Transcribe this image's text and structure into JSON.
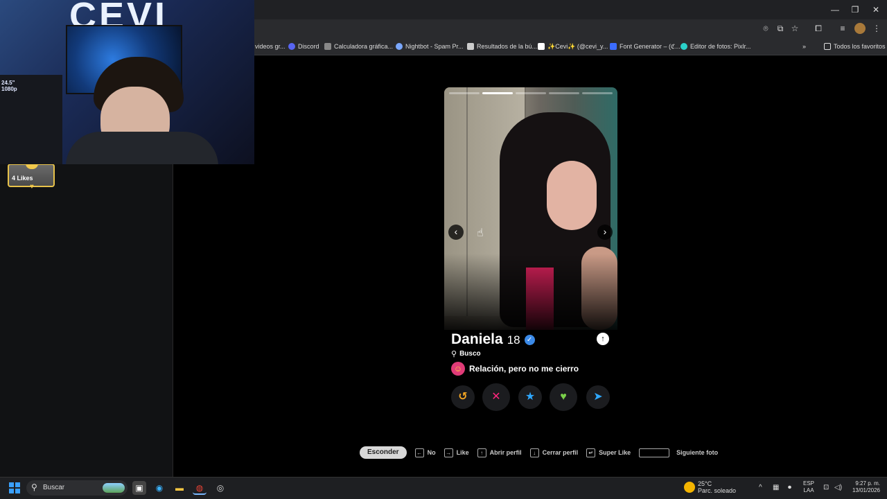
{
  "browser": {
    "bookmarks": [
      {
        "label": "videos gr...",
        "color": "#555"
      },
      {
        "label": "Discord",
        "color": "#5865f2"
      },
      {
        "label": "Calculadora gráfica...",
        "color": "#888"
      },
      {
        "label": "Nightbot - Spam Pr...",
        "color": "#7aa7ff"
      },
      {
        "label": "Resultados de la bú...",
        "color": "#ccc"
      },
      {
        "label": "✨Cevi✨ (@cevi_y...",
        "color": "#111"
      },
      {
        "label": "Font Generator – (ℭ...",
        "color": "#3b6cff"
      },
      {
        "label": "Editor de fotos: Pixlr...",
        "color": "#2ad1c9"
      }
    ],
    "all_bookmarks": "Todos los favoritos",
    "more_icon": "»"
  },
  "webcam": {
    "logo": "CEVI",
    "pc_text": "24.5\"\n1080p"
  },
  "sidebar": {
    "likes_label": "4 Likes"
  },
  "profile": {
    "name": "Daniela",
    "age": "18",
    "looking_for_label": "Busco",
    "relationship": "Relación, pero no me cierro",
    "photo_count": 5,
    "active_photo_index": 1
  },
  "actions": [
    {
      "name": "rewind-button",
      "icon": "↺",
      "color": "#f5a623"
    },
    {
      "name": "nope-button",
      "icon": "✕",
      "color": "#fd267d"
    },
    {
      "name": "super-like-button",
      "icon": "★",
      "color": "#2fa8ff"
    },
    {
      "name": "like-button",
      "icon": "♥",
      "color": "#7ad14a"
    },
    {
      "name": "boost-button",
      "icon": "➤",
      "color": "#2fa8ff"
    }
  ],
  "shortcuts": {
    "hide": "Esconder",
    "no": "No",
    "like": "Like",
    "open_profile": "Abrir perfil",
    "close_profile": "Cerrar perfil",
    "super_like": "Super Like",
    "next_photo": "Siguiente foto"
  },
  "taskbar": {
    "search_placeholder": "Buscar",
    "weather_temp": "25°C",
    "weather_desc": "Parc. soleado",
    "lang1": "ESP",
    "lang2": "LAA",
    "time": "9:27 p. m.",
    "date": "13/01/2026"
  }
}
